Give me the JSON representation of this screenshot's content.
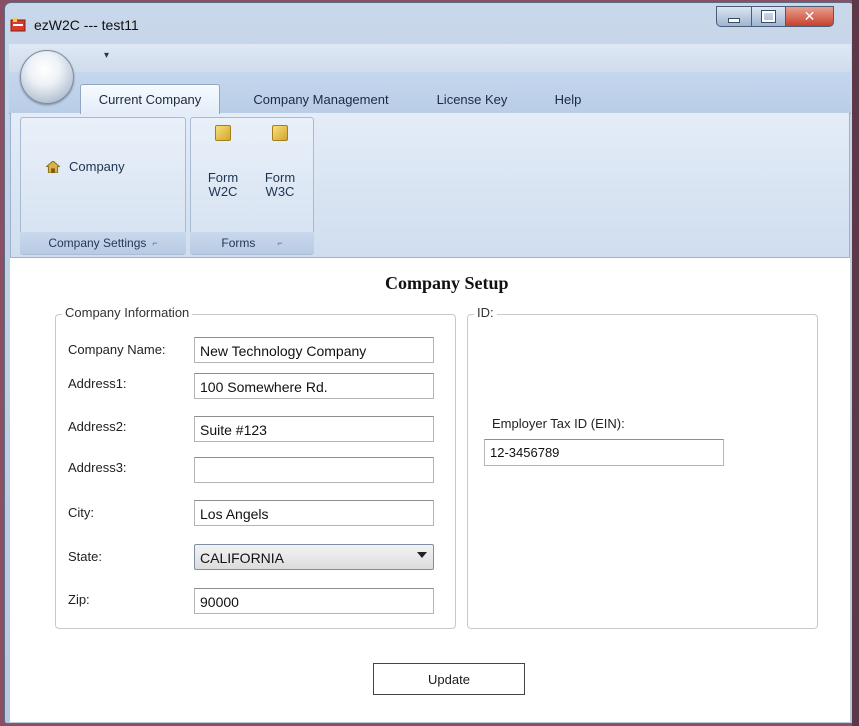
{
  "window": {
    "title": "ezW2C --- test11",
    "icons": {
      "app": "app-icon",
      "minimize": "minimize-icon",
      "maximize": "maximize-icon",
      "close": "close-icon"
    }
  },
  "quick_access": {
    "dropdown_glyph": "▾"
  },
  "tabs": [
    {
      "label": "Current Company",
      "active": true
    },
    {
      "label": "Company Management"
    },
    {
      "label": "License Key"
    },
    {
      "label": "Help"
    }
  ],
  "ribbon": {
    "company_settings": {
      "button_label": "Company",
      "caption": "Company Settings",
      "launcher": "⌐"
    },
    "forms": {
      "form_w2c_label_1": "Form",
      "form_w2c_label_2": "W2C",
      "form_w3c_label_1": "Form",
      "form_w3c_label_2": "W3C",
      "caption": "Forms",
      "launcher": "⌐"
    }
  },
  "page": {
    "title": "Company Setup",
    "company_info": {
      "legend": "Company Information",
      "company_name_label": "Company Name:",
      "company_name_value": "New Technology Company",
      "address1_label": "Address1:",
      "address1_value": "100 Somewhere Rd.",
      "address2_label": "Address2:",
      "address2_value": "Suite #123",
      "address3_label": "Address3:",
      "address3_value": "",
      "city_label": "City:",
      "city_value": "Los Angels",
      "state_label": "State:",
      "state_value": "CALIFORNIA",
      "zip_label": "Zip:",
      "zip_value": "90000"
    },
    "id_section": {
      "legend": "ID:",
      "ein_label": "Employer Tax ID (EIN):",
      "ein_value": "12-3456789"
    },
    "update_button": "Update"
  }
}
